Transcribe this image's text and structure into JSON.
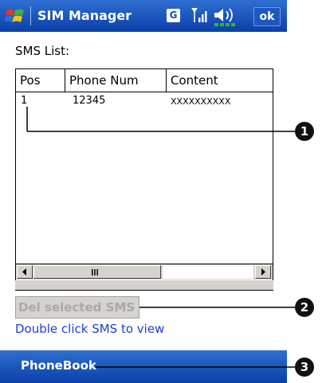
{
  "titlebar": {
    "title": "SIM Manager",
    "badge": "G",
    "ok_label": "ok",
    "icons": [
      "windows-start-icon",
      "signal-icon",
      "speaker-icon"
    ]
  },
  "sms_list": {
    "label": "SMS List:",
    "columns": [
      "Pos",
      "Phone Num",
      "Content"
    ],
    "rows": [
      {
        "pos": "1",
        "phone": "12345",
        "content": "XXXXXXXXXX"
      }
    ]
  },
  "delete_button": {
    "label": "Del selected SMS",
    "enabled": false
  },
  "hint": "Double click SMS to view",
  "bottom_bar": {
    "label": "PhoneBook"
  },
  "callouts": [
    "1",
    "2",
    "3"
  ],
  "colors": {
    "titlebar": "#0b3fa8",
    "hint_text": "#1a3fd8",
    "battery": "#22c122"
  }
}
